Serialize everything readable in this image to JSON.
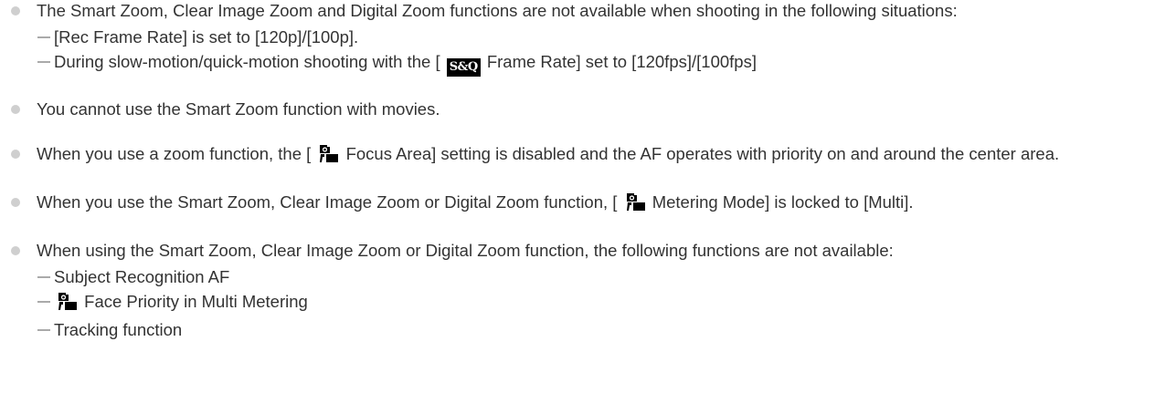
{
  "notes": [
    {
      "text": "The Smart Zoom, Clear Image Zoom and Digital Zoom functions are not available when shooting in the following situations:",
      "sub": [
        {
          "text": "[Rec Frame Rate] is set to [120p]/[100p]."
        },
        {
          "before": "During slow-motion/quick-motion shooting with the [",
          "icon_label": "S&Q",
          "after": " Frame Rate] set to [120fps]/[100fps]"
        }
      ]
    },
    {
      "text": "You cannot use the Smart Zoom function with movies."
    },
    {
      "before": "When you use a zoom function, the [",
      "after": " Focus Area] setting is disabled and the AF operates with priority on and around the center area."
    },
    {
      "before": "When you use the Smart Zoom, Clear Image Zoom or Digital Zoom function, [",
      "after": " Metering Mode] is locked to [Multi]."
    },
    {
      "text": "When using the Smart Zoom, Clear Image Zoom or Digital Zoom function, the following functions are not available:",
      "sub": [
        {
          "text": "Subject Recognition AF"
        },
        {
          "after": " Face Priority in Multi Metering"
        },
        {
          "text": "Tracking function"
        }
      ]
    }
  ],
  "icons": {
    "bullet": "bullet-icon",
    "dash": "dash-icon",
    "still_camera": "still-camera-icon",
    "s_and_q": "s-and-q-icon"
  },
  "colors": {
    "text": "#333333",
    "bullet": "#cfcfcf",
    "dash": "#aaaaaa",
    "icon": "#000000"
  }
}
